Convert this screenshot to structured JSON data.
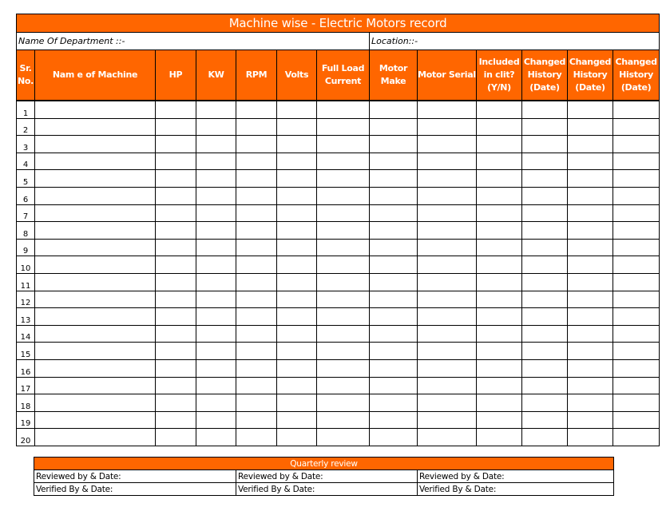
{
  "document": {
    "title": "Machine wise - Electric Motors record",
    "department_label": "Name Of Department ::-",
    "location_label": "Location::-"
  },
  "columns": [
    {
      "line1": "Sr.",
      "line2": "No.",
      "line3": ""
    },
    {
      "line1": "Nam e of Machine",
      "line2": "",
      "line3": ""
    },
    {
      "line1": "HP",
      "line2": "",
      "line3": ""
    },
    {
      "line1": "KW",
      "line2": "",
      "line3": ""
    },
    {
      "line1": "RPM",
      "line2": "",
      "line3": ""
    },
    {
      "line1": "Volts",
      "line2": "",
      "line3": ""
    },
    {
      "line1": "Full Load",
      "line2": "Current",
      "line3": ""
    },
    {
      "line1": "Motor",
      "line2": "Make",
      "line3": ""
    },
    {
      "line1": "Motor Serial",
      "line2": "",
      "line3": ""
    },
    {
      "line1": "Included",
      "line2": "in clit?",
      "line3": "(Y/N)"
    },
    {
      "line1": "Changed",
      "line2": "History",
      "line3": "(Date)"
    },
    {
      "line1": "Changed",
      "line2": "History",
      "line3": "(Date)"
    },
    {
      "line1": "Changed",
      "line2": "History",
      "line3": "(Date)"
    }
  ],
  "rows": [
    "1",
    "2",
    "3",
    "4",
    "5",
    "6",
    "7",
    "8",
    "9",
    "10",
    "11",
    "12",
    "13",
    "14",
    "15",
    "16",
    "17",
    "18",
    "19",
    "20"
  ],
  "review": {
    "title": "Quarterly review",
    "reviewed_label": "Reviewed by & Date:",
    "verified_label": "Verified By & Date:"
  },
  "colors": {
    "accent": "#ff6600",
    "header_text": "#ffffff",
    "border": "#000000"
  }
}
